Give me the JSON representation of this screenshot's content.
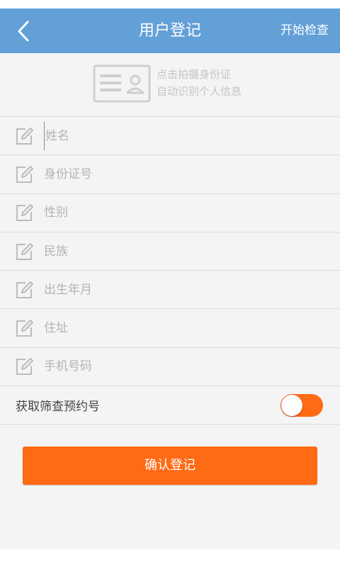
{
  "header": {
    "title": "用户登记",
    "action_label": "开始检查",
    "back_icon": "chevron-left-icon",
    "background_color": "#63a0d8"
  },
  "id_scan": {
    "line1": "点击拍摄身份证",
    "line2": "自动识别个人信息",
    "icon": "id-card-icon"
  },
  "form": {
    "fields": [
      {
        "placeholder": "姓名",
        "value": ""
      },
      {
        "placeholder": "身份证号",
        "value": ""
      },
      {
        "placeholder": "性别",
        "value": ""
      },
      {
        "placeholder": "民族",
        "value": ""
      },
      {
        "placeholder": "出生年月",
        "value": ""
      },
      {
        "placeholder": "住址",
        "value": ""
      },
      {
        "placeholder": "手机号码",
        "value": ""
      }
    ],
    "field_icon": "edit-icon"
  },
  "toggle": {
    "label": "获取筛查预约号",
    "state": "on",
    "color": "#ff6a14"
  },
  "confirm_button": {
    "label": "确认登记",
    "color": "#ff6a14"
  }
}
